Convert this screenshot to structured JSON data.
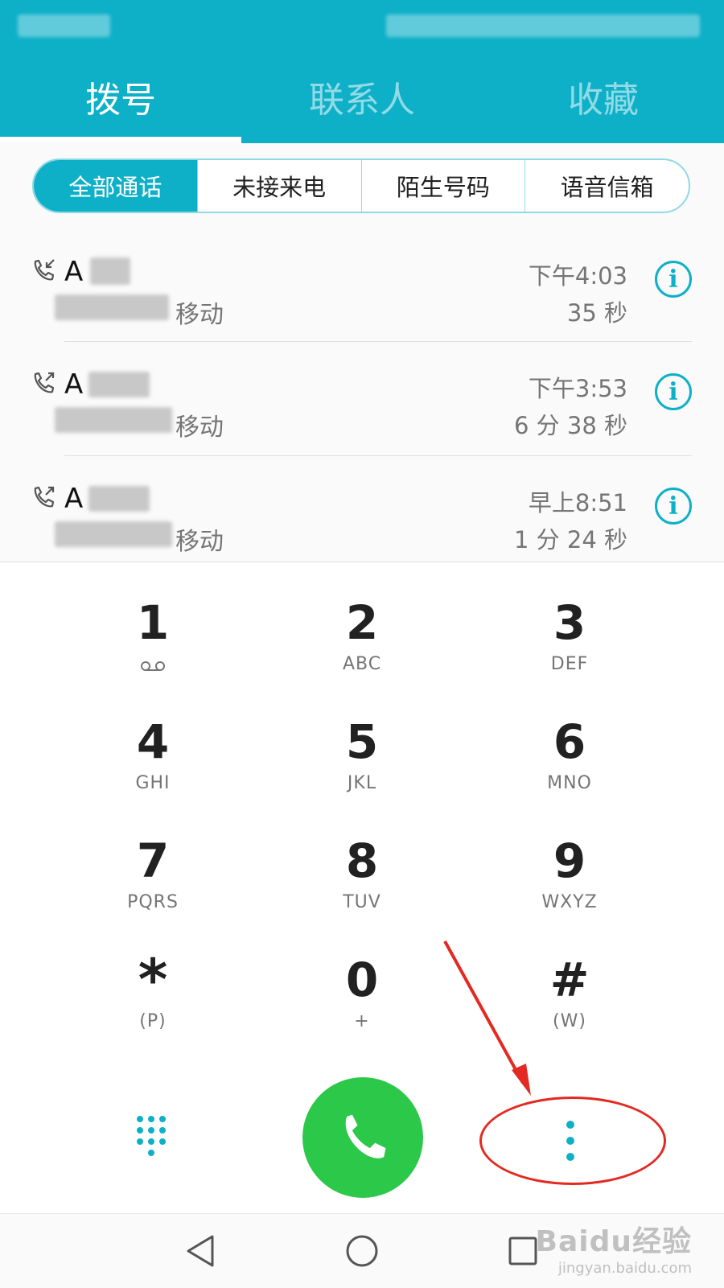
{
  "header": {
    "tabs": [
      {
        "label": "拨号",
        "active": true
      },
      {
        "label": "联系人",
        "active": false
      },
      {
        "label": "收藏",
        "active": false
      }
    ],
    "accent_color": "#0eb0c8"
  },
  "filter": {
    "segments": [
      "全部通话",
      "未接来电",
      "陌生号码",
      "语音信箱"
    ],
    "selected": "全部通话"
  },
  "calls": [
    {
      "type": "incoming",
      "name_initial": "A",
      "carrier": "移动",
      "time": "下午4:03",
      "duration": "35 秒"
    },
    {
      "type": "outgoing",
      "name_initial": "A",
      "carrier": "移动",
      "time": "下午3:53",
      "duration": "6 分 38 秒"
    },
    {
      "type": "outgoing",
      "name_initial": "A",
      "carrier": "移动",
      "time": "早上8:51",
      "duration": "1 分 24 秒"
    }
  ],
  "info_icon": "i",
  "dialpad": {
    "keys": [
      {
        "digit": "1",
        "letters": ""
      },
      {
        "digit": "2",
        "letters": "ABC"
      },
      {
        "digit": "3",
        "letters": "DEF"
      },
      {
        "digit": "4",
        "letters": "GHI"
      },
      {
        "digit": "5",
        "letters": "JKL"
      },
      {
        "digit": "6",
        "letters": "MNO"
      },
      {
        "digit": "7",
        "letters": "PQRS"
      },
      {
        "digit": "8",
        "letters": "TUV"
      },
      {
        "digit": "9",
        "letters": "WXYZ"
      },
      {
        "digit": "*",
        "letters": "(P)"
      },
      {
        "digit": "0",
        "letters": "+"
      },
      {
        "digit": "#",
        "letters": "(W)"
      }
    ],
    "call_button_color": "#2cc84a"
  },
  "annotation_color": "#e32a22",
  "watermark": {
    "brand": "Baidu经验",
    "url": "jingyan.baidu.com"
  }
}
